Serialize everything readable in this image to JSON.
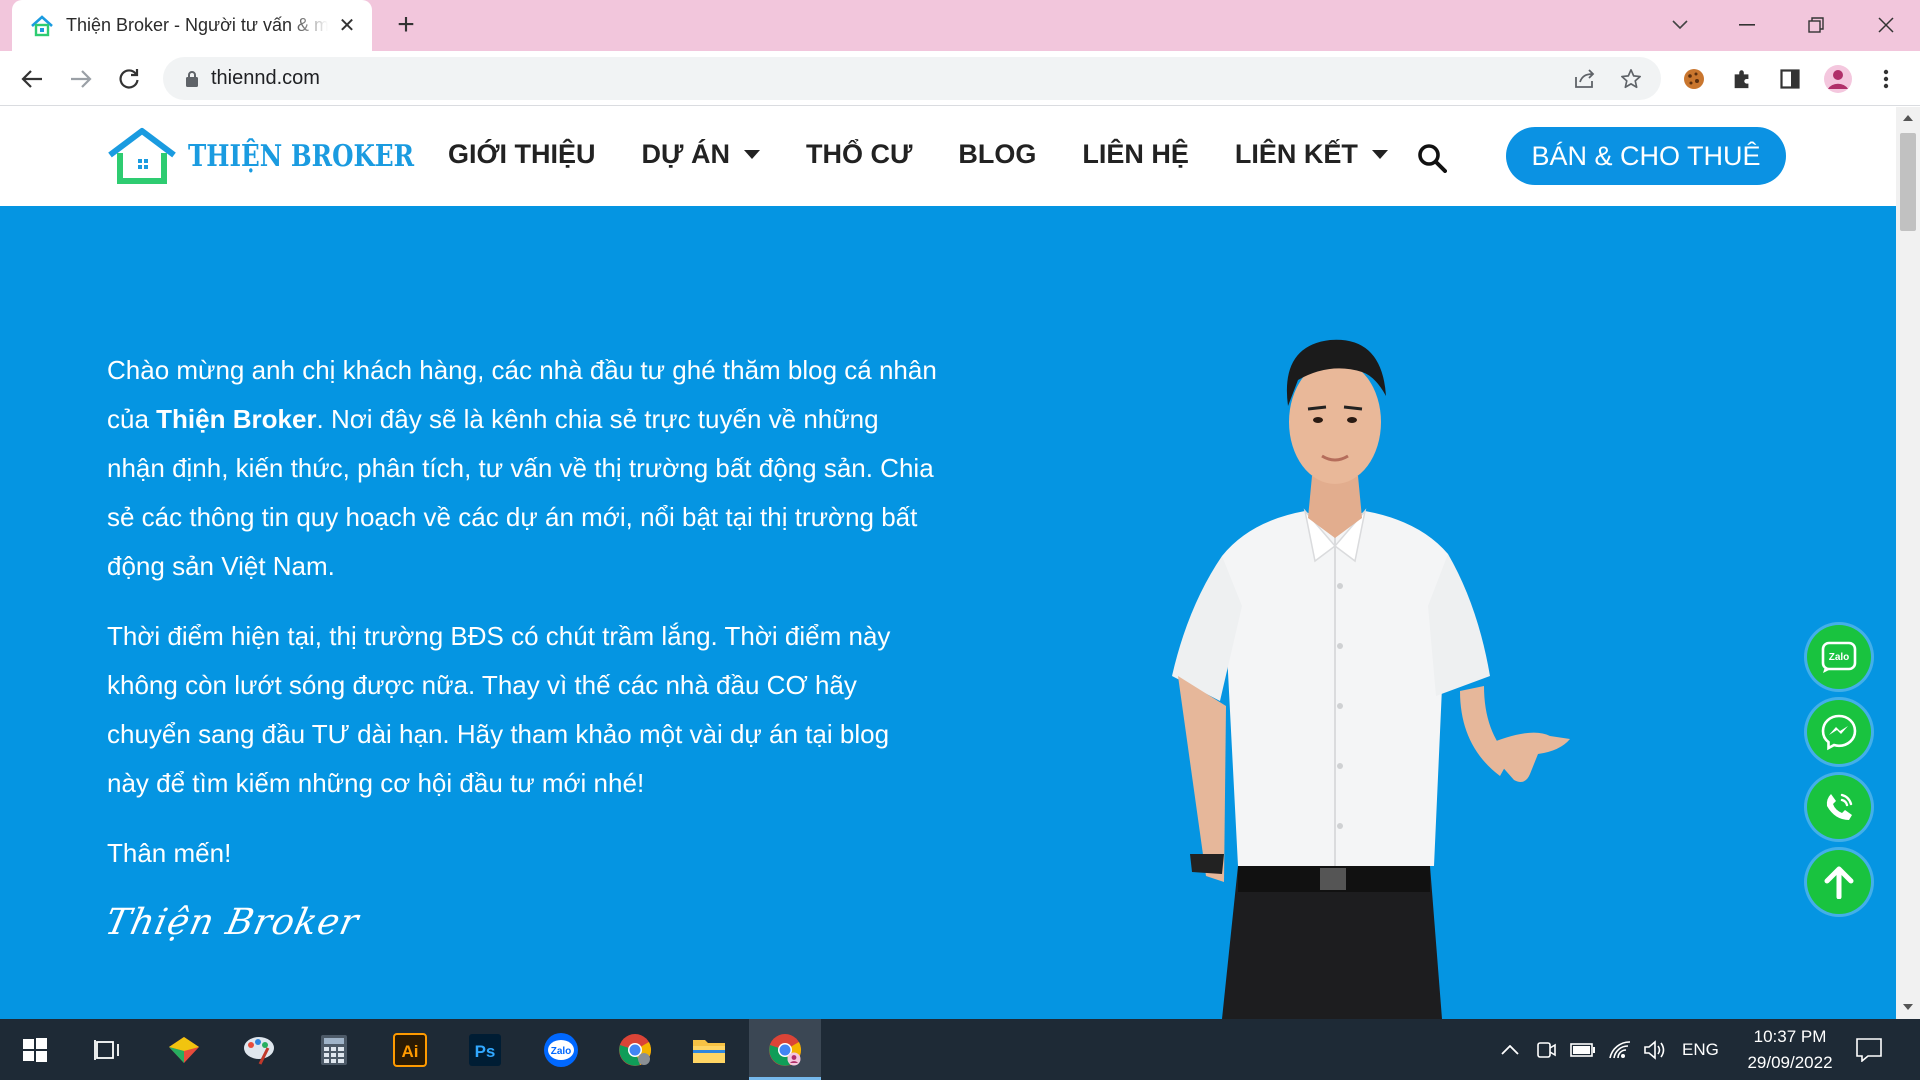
{
  "browser": {
    "tab_title": "Thiện Broker - Người tư vấn & môi giới",
    "new_tab_symbol": "+",
    "url": "thiennd.com"
  },
  "site": {
    "logo_text": "THIỆN BROKER",
    "nav": [
      {
        "label": "GIỚI THIỆU",
        "has_dropdown": false
      },
      {
        "label": "DỰ ÁN",
        "has_dropdown": true
      },
      {
        "label": "THỔ CƯ",
        "has_dropdown": false
      },
      {
        "label": "BLOG",
        "has_dropdown": false
      },
      {
        "label": "LIÊN HỆ",
        "has_dropdown": false
      },
      {
        "label": "LIÊN KẾT",
        "has_dropdown": true
      }
    ],
    "cta_label": "BÁN & CHO THUÊ",
    "colors": {
      "brand_blue": "#0595e2",
      "cta_blue": "#0b92e3",
      "fab_green": "#19c33f"
    }
  },
  "hero": {
    "p1_a": "Chào mừng anh chị khách hàng, các nhà đầu tư ghé thăm blog cá nhân của ",
    "p1_bold": "Thiện Broker",
    "p1_b": ". Nơi đây sẽ là kênh chia sẻ trực tuyến về những nhận định, kiến thức, phân tích, tư vấn về thị trường bất động sản. Chia sẻ các thông tin quy hoạch về các dự án mới, nổi bật tại thị trường bất động sản Việt Nam.",
    "p2": "Thời điểm hiện tại, thị trường BĐS có chút trầm lắng. Thời điểm này không còn lướt sóng được nữa. Thay vì thế các nhà đầu CƠ hãy chuyển sang đầu TƯ dài hạn. Hãy tham khảo một vài dự án tại blog này để tìm kiếm những cơ hội đầu tư mới nhé!",
    "p3": "Thân mến!",
    "signature": "Thiện Broker"
  },
  "floating_buttons": {
    "zalo_label": "Zalo",
    "icons": [
      "zalo-icon",
      "messenger-icon",
      "phone-icon",
      "arrow-up-icon"
    ]
  },
  "taskbar": {
    "illustrator_label": "Ai",
    "photoshop_label": "Ps",
    "zalo_label": "Zalo",
    "language": "ENG",
    "time": "10:37 PM",
    "date": "29/09/2022"
  }
}
